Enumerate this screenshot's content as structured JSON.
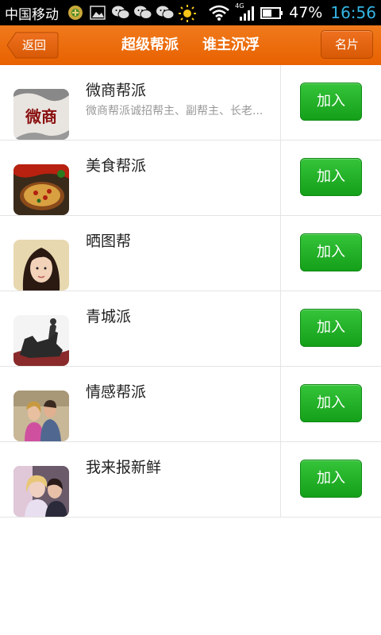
{
  "status_bar": {
    "carrier": "中国移动",
    "network": "4G",
    "battery_percent": "47%",
    "time": "16:56",
    "icons": [
      "app-notification-icon",
      "image-notification-icon",
      "wechat-icon",
      "wechat-icon",
      "wechat-icon",
      "weather-sun-icon",
      "wifi-icon",
      "signal-icon",
      "battery-icon"
    ],
    "time_color": "#33b5e5"
  },
  "header": {
    "back_label": "返回",
    "tabs": [
      {
        "label": "超级帮派"
      },
      {
        "label": "谁主沉浮"
      }
    ],
    "card_button_label": "名片",
    "accent_color": "#e86100"
  },
  "groups": [
    {
      "name": "微商帮派",
      "description": "微商帮派诚招帮主、副帮主、长老...",
      "join_label": "加入"
    },
    {
      "name": "美食帮派",
      "description": "",
      "join_label": "加入"
    },
    {
      "name": "晒图帮",
      "description": "",
      "join_label": "加入"
    },
    {
      "name": "青城派",
      "description": "",
      "join_label": "加入"
    },
    {
      "name": "情感帮派",
      "description": "",
      "join_label": "加入"
    },
    {
      "name": "我来报新鲜",
      "description": "",
      "join_label": "加入"
    }
  ],
  "avatar_text": {
    "weishang": "微商"
  },
  "join_button_color": "#14a019"
}
